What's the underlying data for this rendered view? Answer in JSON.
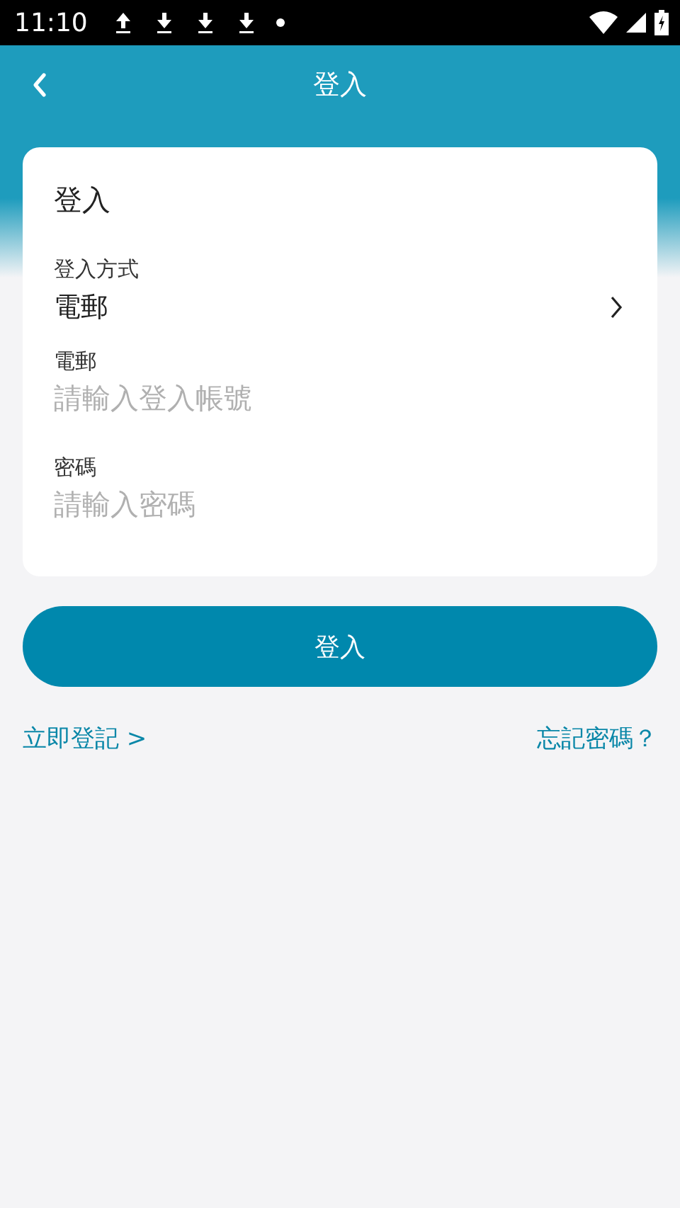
{
  "status_bar": {
    "time": "11:10"
  },
  "app_bar": {
    "title": "登入"
  },
  "card": {
    "heading": "登入",
    "method": {
      "label": "登入方式",
      "value": "電郵"
    },
    "fields": [
      {
        "label": "電郵",
        "placeholder": "請輸入登入帳號"
      },
      {
        "label": "密碼",
        "placeholder": "請輸入密碼"
      }
    ]
  },
  "submit_button": "登入",
  "links": {
    "register": "立即登記 >",
    "forgot": "忘記密碼？"
  }
}
